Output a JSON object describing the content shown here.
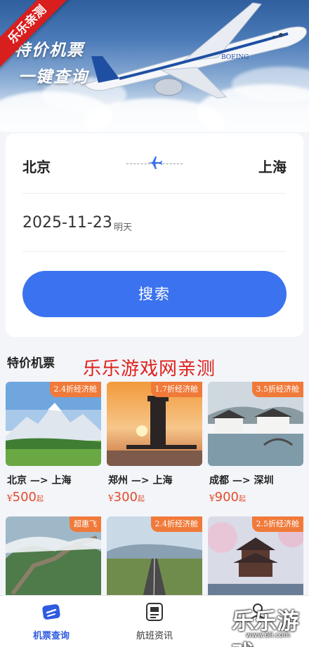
{
  "hero": {
    "title_line1": "特价机票",
    "title_line2": "一键查询",
    "ribbon": "乐乐亲测",
    "plane_text": "BOEING"
  },
  "search": {
    "from_city": "北京",
    "to_city": "上海",
    "date": "2025-11-23",
    "date_hint": "明天",
    "button_label": "搜索"
  },
  "deals_section": {
    "title": "特价机票",
    "watermark": "乐乐游戏网亲测"
  },
  "deals": [
    {
      "badge": "2.4折经济舱",
      "from": "北京",
      "arrow": "—>",
      "to": "上海",
      "currency": "¥",
      "price": "500",
      "unit": "起"
    },
    {
      "badge": "1.7折经济舱",
      "from": "郑州",
      "arrow": "—>",
      "to": "上海",
      "currency": "¥",
      "price": "300",
      "unit": "起"
    },
    {
      "badge": "3.5折经济舱",
      "from": "成都",
      "arrow": "—>",
      "to": "深圳",
      "currency": "¥",
      "price": "900",
      "unit": "起"
    },
    {
      "badge": "超惠飞"
    },
    {
      "badge": "2.4折经济舱"
    },
    {
      "badge": "2.5折经济舱"
    }
  ],
  "tabbar": {
    "tabs": [
      {
        "label": "机票查询",
        "active": true
      },
      {
        "label": "航班资讯",
        "active": false
      },
      {
        "label": "",
        "active": false
      }
    ]
  },
  "corner_watermark": {
    "text": "乐乐游戏",
    "url": "www.6ll.com"
  },
  "colors": {
    "accent": "#3b72ef",
    "price": "#e34b2c",
    "badge": "#f07a3a",
    "active_tab": "#2f5be0"
  }
}
